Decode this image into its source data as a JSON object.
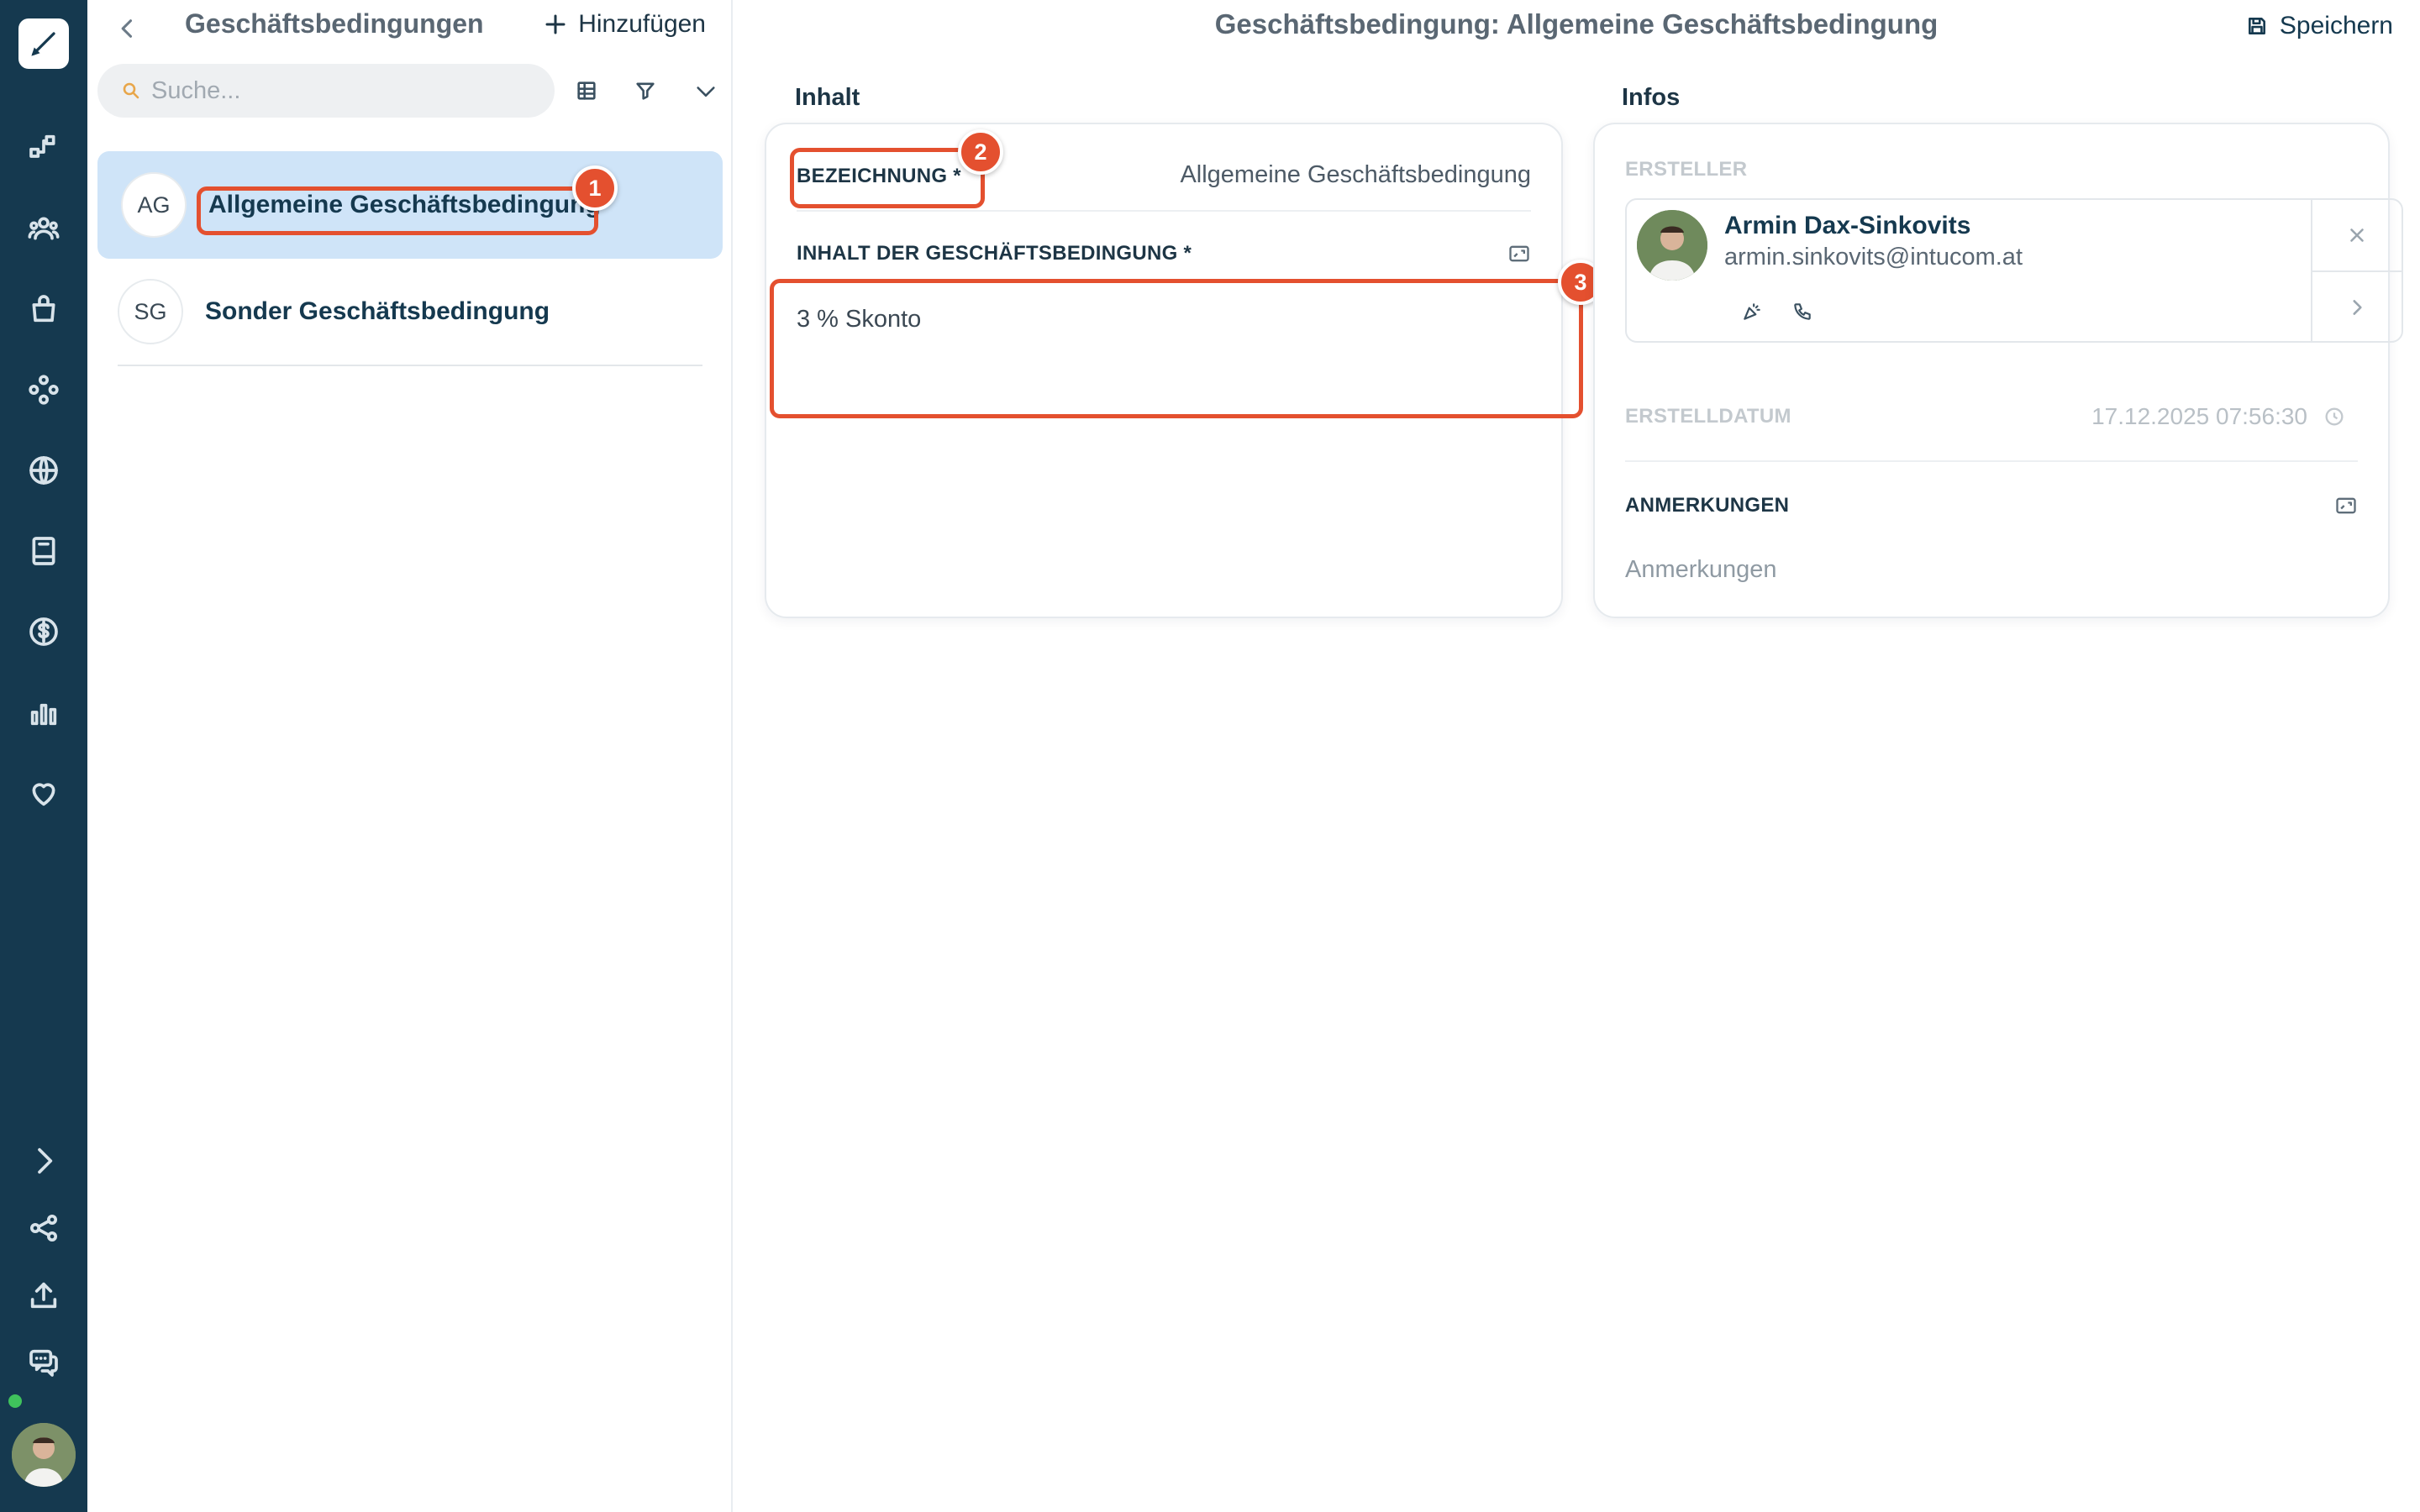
{
  "rail": {
    "icons": [
      "pencil-icon",
      "flow-icon",
      "users-icon",
      "bag-icon",
      "modules-icon",
      "globe-icon",
      "book-icon",
      "dollar-icon",
      "chart-icon",
      "heart-icon",
      "chevron-right-icon",
      "share-icon",
      "upload-icon",
      "chat-icon"
    ],
    "accent": "#15394f",
    "online_color": "#3fc25c"
  },
  "list": {
    "title": "Geschäftsbedingungen",
    "add_label": "Hinzufügen",
    "search_placeholder": "Suche...",
    "items": [
      {
        "initials": "AG",
        "name": "Allgemeine Geschäftsbedingung",
        "selected": true
      },
      {
        "initials": "SG",
        "name": "Sonder Geschäftsbedingung",
        "selected": false
      }
    ]
  },
  "detail": {
    "title": "Geschäftsbedingung: Allgemeine Geschäftsbedingung",
    "save_label": "Speichern",
    "content": {
      "section_label": "Inhalt",
      "bezeichnung_label": "BEZEICHNUNG *",
      "bezeichnung_value": "Allgemeine Geschäftsbedingung",
      "inhalt_label": "INHALT DER GESCHÄFTSBEDINGUNG *",
      "inhalt_value": "3 % Skonto"
    },
    "infos": {
      "section_label": "Infos",
      "ersteller_label": "ERSTELLER",
      "creator_name": "Armin Dax-Sinkovits",
      "creator_email": "armin.sinkovits@intucom.at",
      "erstelldatum_label": "ERSTELLDATUM",
      "erstelldatum_value": "17.12.2025 07:56:30",
      "anmerkungen_label": "ANMERKUNGEN",
      "anmerkungen_placeholder": "Anmerkungen"
    }
  },
  "annotations": {
    "color": "#e4502f",
    "markers": [
      "1",
      "2",
      "3"
    ]
  }
}
